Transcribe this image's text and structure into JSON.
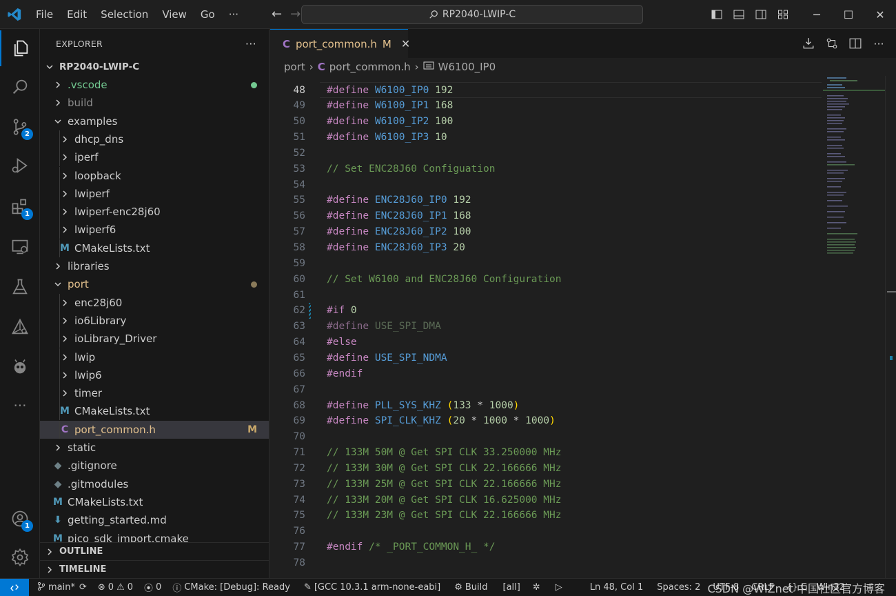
{
  "titlebar": {
    "menu": [
      "File",
      "Edit",
      "Selection",
      "View",
      "Go",
      "···"
    ],
    "search": "RP2040-LWIP-C"
  },
  "activity": {
    "items": [
      {
        "icon": "explorer-icon",
        "badge": ""
      },
      {
        "icon": "search-icon",
        "badge": ""
      },
      {
        "icon": "source-control-icon",
        "badge": "2"
      },
      {
        "icon": "run-debug-icon",
        "badge": ""
      },
      {
        "icon": "extensions-icon",
        "badge": "1"
      },
      {
        "icon": "remote-explorer-icon",
        "badge": ""
      },
      {
        "icon": "testing-icon",
        "badge": ""
      },
      {
        "icon": "cmake-icon",
        "badge": ""
      },
      {
        "icon": "platformio-icon",
        "badge": ""
      },
      {
        "icon": "more-icon",
        "badge": ""
      }
    ],
    "account_badge": "1"
  },
  "sidebar": {
    "title": "EXPLORER",
    "more": "···",
    "root": "RP2040-LWIP-C",
    "items": [
      {
        "label": ".vscode",
        "type": "folder",
        "depth": 1,
        "color": "#73c991"
      },
      {
        "label": "build",
        "type": "folder",
        "depth": 1,
        "color": "#8c8c8c"
      },
      {
        "label": "examples",
        "type": "folder-open",
        "depth": 1
      },
      {
        "label": "dhcp_dns",
        "type": "folder",
        "depth": 2
      },
      {
        "label": "iperf",
        "type": "folder",
        "depth": 2
      },
      {
        "label": "loopback",
        "type": "folder",
        "depth": 2
      },
      {
        "label": "lwiperf",
        "type": "folder",
        "depth": 2
      },
      {
        "label": "lwiperf-enc28j60",
        "type": "folder",
        "depth": 2
      },
      {
        "label": "lwiperf6",
        "type": "folder",
        "depth": 2
      },
      {
        "label": "CMakeLists.txt",
        "type": "cmake",
        "depth": 2
      },
      {
        "label": "libraries",
        "type": "folder",
        "depth": 1
      },
      {
        "label": "port",
        "type": "folder-open",
        "depth": 1,
        "color": "#e2c08d"
      },
      {
        "label": "enc28j60",
        "type": "folder",
        "depth": 2
      },
      {
        "label": "io6Library",
        "type": "folder",
        "depth": 2
      },
      {
        "label": "ioLibrary_Driver",
        "type": "folder",
        "depth": 2
      },
      {
        "label": "lwip",
        "type": "folder",
        "depth": 2
      },
      {
        "label": "lwip6",
        "type": "folder",
        "depth": 2
      },
      {
        "label": "timer",
        "type": "folder",
        "depth": 2
      },
      {
        "label": "CMakeLists.txt",
        "type": "cmake",
        "depth": 2
      },
      {
        "label": "port_common.h",
        "type": "c-header",
        "depth": 2,
        "color": "#e2c08d",
        "status": "M",
        "selected": true
      },
      {
        "label": "static",
        "type": "folder",
        "depth": 1
      },
      {
        "label": ".gitignore",
        "type": "git",
        "depth": 1
      },
      {
        "label": ".gitmodules",
        "type": "git",
        "depth": 1
      },
      {
        "label": "CMakeLists.txt",
        "type": "cmake",
        "depth": 1
      },
      {
        "label": "getting_started.md",
        "type": "markdown",
        "depth": 1
      },
      {
        "label": "pico_sdk_import.cmake",
        "type": "cmake",
        "depth": 1
      }
    ],
    "sections": [
      "OUTLINE",
      "TIMELINE"
    ]
  },
  "editor": {
    "tab": {
      "name": "port_common.h",
      "status": "M",
      "close": "✕"
    },
    "breadcrumb": {
      "folder": "port",
      "file": "port_common.h",
      "symbol": "W6100_IP0"
    },
    "current_line": 48,
    "lines": [
      {
        "n": 48,
        "t": [
          [
            "k",
            "#define "
          ],
          [
            "m",
            "W6100_IP0"
          ],
          [
            "p",
            " "
          ],
          [
            "n",
            "192"
          ]
        ]
      },
      {
        "n": 49,
        "t": [
          [
            "k",
            "#define "
          ],
          [
            "m",
            "W6100_IP1"
          ],
          [
            "p",
            " "
          ],
          [
            "n",
            "168"
          ]
        ]
      },
      {
        "n": 50,
        "t": [
          [
            "k",
            "#define "
          ],
          [
            "m",
            "W6100_IP2"
          ],
          [
            "p",
            " "
          ],
          [
            "n",
            "100"
          ]
        ]
      },
      {
        "n": 51,
        "t": [
          [
            "k",
            "#define "
          ],
          [
            "m",
            "W6100_IP3"
          ],
          [
            "p",
            " "
          ],
          [
            "n",
            "10"
          ]
        ]
      },
      {
        "n": 52,
        "t": []
      },
      {
        "n": 53,
        "t": [
          [
            "c",
            "// Set ENC28J60 Configuation"
          ]
        ]
      },
      {
        "n": 54,
        "t": []
      },
      {
        "n": 55,
        "t": [
          [
            "k",
            "#define "
          ],
          [
            "m",
            "ENC28J60_IP0"
          ],
          [
            "p",
            " "
          ],
          [
            "n",
            "192"
          ]
        ]
      },
      {
        "n": 56,
        "t": [
          [
            "k",
            "#define "
          ],
          [
            "m",
            "ENC28J60_IP1"
          ],
          [
            "p",
            " "
          ],
          [
            "n",
            "168"
          ]
        ]
      },
      {
        "n": 57,
        "t": [
          [
            "k",
            "#define "
          ],
          [
            "m",
            "ENC28J60_IP2"
          ],
          [
            "p",
            " "
          ],
          [
            "n",
            "100"
          ]
        ]
      },
      {
        "n": 58,
        "t": [
          [
            "k",
            "#define "
          ],
          [
            "m",
            "ENC28J60_IP3"
          ],
          [
            "p",
            " "
          ],
          [
            "n",
            "20"
          ]
        ]
      },
      {
        "n": 59,
        "t": []
      },
      {
        "n": 60,
        "t": [
          [
            "c",
            "// Set W6100 and ENC28J60 Configuration"
          ]
        ]
      },
      {
        "n": 61,
        "t": []
      },
      {
        "n": 62,
        "t": [
          [
            "k",
            "#if "
          ],
          [
            "n",
            "0"
          ]
        ]
      },
      {
        "n": 63,
        "t": [
          [
            "mk",
            "#define "
          ],
          [
            "dim",
            "USE_SPI_DMA"
          ]
        ]
      },
      {
        "n": 64,
        "t": [
          [
            "k",
            "#else"
          ]
        ]
      },
      {
        "n": 65,
        "t": [
          [
            "k",
            "#define "
          ],
          [
            "m",
            "USE_SPI_NDMA"
          ]
        ]
      },
      {
        "n": 66,
        "t": [
          [
            "k",
            "#endif"
          ]
        ]
      },
      {
        "n": 67,
        "t": []
      },
      {
        "n": 68,
        "t": [
          [
            "k",
            "#define "
          ],
          [
            "m",
            "PLL_SYS_KHZ"
          ],
          [
            "p",
            " "
          ],
          [
            "pl",
            "("
          ],
          [
            "n",
            "133"
          ],
          [
            "p",
            " * "
          ],
          [
            "n",
            "1000"
          ],
          [
            "pl",
            ")"
          ]
        ]
      },
      {
        "n": 69,
        "t": [
          [
            "k",
            "#define "
          ],
          [
            "m",
            "SPI_CLK_KHZ"
          ],
          [
            "p",
            " "
          ],
          [
            "pl",
            "("
          ],
          [
            "n",
            "20"
          ],
          [
            "p",
            " * "
          ],
          [
            "n",
            "1000"
          ],
          [
            "p",
            " * "
          ],
          [
            "n",
            "1000"
          ],
          [
            "pl",
            ")"
          ]
        ]
      },
      {
        "n": 70,
        "t": []
      },
      {
        "n": 71,
        "t": [
          [
            "c",
            "// 133M 50M @ Get SPI CLK 33.250000 MHz"
          ]
        ]
      },
      {
        "n": 72,
        "t": [
          [
            "c",
            "// 133M 30M @ Get SPI CLK 22.166666 MHz"
          ]
        ]
      },
      {
        "n": 73,
        "t": [
          [
            "c",
            "// 133M 25M @ Get SPI CLK 22.166666 MHz"
          ]
        ]
      },
      {
        "n": 74,
        "t": [
          [
            "c",
            "// 133M 20M @ Get SPI CLK 16.625000 MHz"
          ]
        ]
      },
      {
        "n": 75,
        "t": [
          [
            "c",
            "// 133M 23M @ Get SPI CLK 22.166666 MHz"
          ]
        ]
      },
      {
        "n": 76,
        "t": []
      },
      {
        "n": 77,
        "t": [
          [
            "k",
            "#endif "
          ],
          [
            "c",
            "/* _PORT_COMMON_H_ */"
          ]
        ]
      },
      {
        "n": 78,
        "t": []
      }
    ]
  },
  "statusbar": {
    "branch": "main*",
    "errors": "0",
    "warnings": "0",
    "ports": "0",
    "cmake": "CMake: [Debug]: Ready",
    "kit": "[GCC 10.3.1 arm-none-eabi]",
    "build": "Build",
    "target": "[all]",
    "position": "Ln 48, Col 1",
    "spaces": "Spaces: 2",
    "encoding": "UTF-8",
    "eol": "CRLF",
    "language": "{} C",
    "platform": "Win32",
    "watermark": "CSDN @WIZnet 中国社区官方博客"
  }
}
